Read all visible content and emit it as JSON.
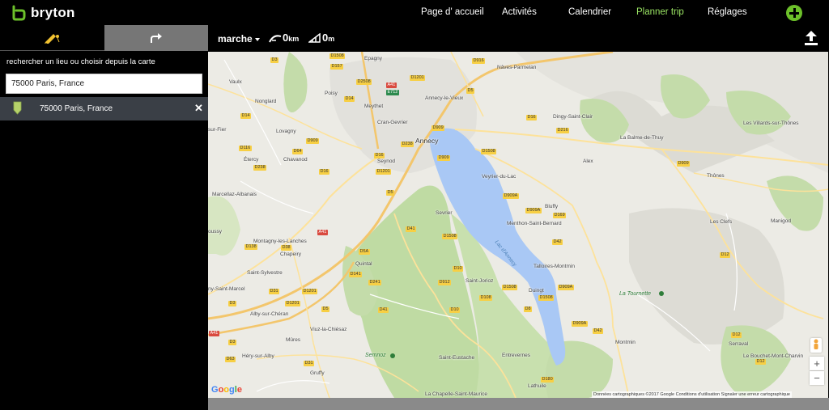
{
  "brand": {
    "name": "bryton"
  },
  "nav": [
    {
      "label": "Page d' accueil",
      "active": false
    },
    {
      "label": "Activités",
      "active": false
    },
    {
      "label": "Calendrier",
      "active": false
    },
    {
      "label": "Planner trip",
      "active": true
    },
    {
      "label": "Réglages",
      "active": false
    }
  ],
  "colors": {
    "accent": "#6cc02a",
    "active_nav": "#9be564",
    "lake": "#a9c8f5",
    "forest": "#c4dcaa",
    "result_bg": "#3a3f46"
  },
  "left_panel": {
    "tabs": [
      {
        "icon": "draw-route-icon"
      },
      {
        "icon": "redo-arrow-icon"
      }
    ],
    "search_hint": "rechercher un lieu ou choisir depuis la carte",
    "search_value": "75000 Paris, France",
    "results": [
      {
        "label": "75000 Paris, France",
        "icon": "map-pin-icon"
      }
    ]
  },
  "toolbar": {
    "mode": "marche",
    "distance": {
      "value": "0",
      "unit": "km"
    },
    "elevation": {
      "value": "0",
      "unit": "m"
    },
    "upload_icon": "upload-icon"
  },
  "map": {
    "places": [
      {
        "name": "Vaulx"
      },
      {
        "name": "Epagny"
      },
      {
        "name": "Nâves-Parmelan"
      },
      {
        "name": "Nonglard"
      },
      {
        "name": "Poisy"
      },
      {
        "name": "Meythet"
      },
      {
        "name": "Annecy-le-Vieux"
      },
      {
        "name": "Dingy-Saint-Clair"
      },
      {
        "name": "Cran-Gevrier"
      },
      {
        "name": "Lovagny"
      },
      {
        "name": "Annecy"
      },
      {
        "name": "La Balme-de-Thuy"
      },
      {
        "name": "Les Villards-sur-Thônes"
      },
      {
        "name": "Étercy"
      },
      {
        "name": "Chavanod"
      },
      {
        "name": "Seynod"
      },
      {
        "name": "Veyrier-du-Lac"
      },
      {
        "name": "Alex"
      },
      {
        "name": "Thônes"
      },
      {
        "name": "Marcellaz-Albanais"
      },
      {
        "name": "Bluffy"
      },
      {
        "name": "Menthon-Saint-Bernard"
      },
      {
        "name": "Sevrier"
      },
      {
        "name": "Les Clefs"
      },
      {
        "name": "Manigod"
      },
      {
        "name": "Montagny-les-Lanches"
      },
      {
        "name": "Chapeiry"
      },
      {
        "name": "Talloires-Montmin"
      },
      {
        "name": "Quintal"
      },
      {
        "name": "Saint-Sylvestre"
      },
      {
        "name": "Saint-Jorioz"
      },
      {
        "name": "Duingt"
      },
      {
        "name": "Alby-sur-Chéran"
      },
      {
        "name": "Viuz-la-Chiésaz"
      },
      {
        "name": "Mûres"
      },
      {
        "name": "Montmin"
      },
      {
        "name": "Serraval"
      },
      {
        "name": "Héry-sur-Alby"
      },
      {
        "name": "Saint-Eustache"
      },
      {
        "name": "Entrevernes"
      },
      {
        "name": "Le Bouchet-Mont-Charvin"
      },
      {
        "name": "Gruffy"
      },
      {
        "name": "Lathuile"
      },
      {
        "name": "La Chapelle-Saint-Maurice"
      },
      {
        "name": "sur-Fier"
      },
      {
        "name": "oussy"
      },
      {
        "name": "ny-Saint-Marcel"
      }
    ],
    "lake_label": "Lac d'Annecy",
    "peaks": [
      {
        "name": "La Tournette"
      },
      {
        "name": "Semnoz"
      }
    ],
    "roads": [
      "D3",
      "D1508",
      "D916",
      "D157",
      "D1201",
      "D2508",
      "D14",
      "D5",
      "D909",
      "D16",
      "D216",
      "D909",
      "D1508",
      "D909",
      "D64",
      "D116",
      "D238",
      "D238",
      "D16",
      "D1201",
      "D16",
      "D909A",
      "D909",
      "D5",
      "D909A",
      "D169",
      "D42",
      "D12",
      "D41",
      "D5A",
      "D1508",
      "D138",
      "D38",
      "D10",
      "D141",
      "D912",
      "D241",
      "D1508",
      "D909A",
      "D31",
      "D1201",
      "D108",
      "D1508",
      "D5",
      "D8",
      "D1201",
      "D41",
      "D10",
      "D909A",
      "D42",
      "D12",
      "D63",
      "D31",
      "D12",
      "D180",
      "D14",
      "D3",
      "D3"
    ],
    "highways": [
      "A41",
      "A41",
      "A41",
      "E712"
    ],
    "google_logo": "Google",
    "credits": "Données cartographiques ©2017 Google    Conditions d'utilisation    Signaler une erreur cartographique",
    "zoom_in": "+",
    "zoom_out": "−"
  }
}
